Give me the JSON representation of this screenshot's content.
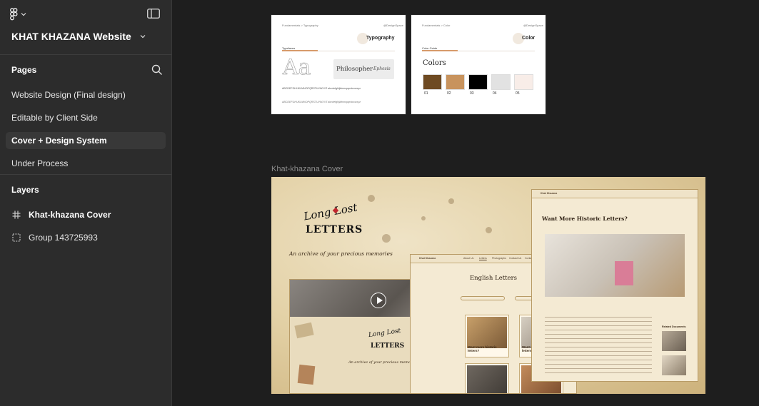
{
  "file": {
    "name": "KHAT KHAZANA Website"
  },
  "pages": {
    "title": "Pages",
    "items": [
      {
        "label": "Website Design (Final design)"
      },
      {
        "label": "Editable by Client Side"
      },
      {
        "label": "Cover + Design System"
      },
      {
        "label": "Under Process"
      }
    ]
  },
  "layers": {
    "title": "Layers",
    "items": [
      {
        "label": "Khat-khazana Cover"
      },
      {
        "label": "Group 143725993"
      }
    ]
  },
  "canvas": {
    "typography_frame": {
      "breadcrumb": "Fundamentals > Typography",
      "tag": "@DesignSpace",
      "title": "Typography",
      "section": "Typefaces",
      "sample_glyph": "Aa",
      "font_name": "Philosopher",
      "script_sample": "Ephesis",
      "alphabet": "ABCDEFGHIJKLMNOPQRSTUVWXYZ abcdefghijklmnopqrstuvwxyz"
    },
    "color_frame": {
      "breadcrumb": "Fundamentals > Color",
      "tag": "@DesignSpace",
      "title": "Color",
      "section": "Color Guide",
      "heading": "Colors",
      "swatches": [
        {
          "label": "01",
          "color": "#6e4a22"
        },
        {
          "label": "02",
          "color": "#c8935d"
        },
        {
          "label": "03",
          "color": "#000000"
        },
        {
          "label": "04",
          "color": "#e2e2e2"
        },
        {
          "label": "05",
          "color": "#f8ede8"
        }
      ]
    },
    "cover": {
      "label": "Khat-khazana Cover",
      "logo_line1": "Long Lost",
      "logo_line2": "LETTERS",
      "tagline": "An archive of your precious memories",
      "mini_site": {
        "brand": "Khat Khazana",
        "nav": [
          "About Us",
          "Letters",
          "Photographs",
          "Contact Us",
          "Contact Editor & Photographer",
          "Share"
        ],
        "page_title": "English Letters",
        "card1": "Want more historic letters?",
        "card2": "Want more historic letters?"
      },
      "right_site": {
        "heading": "Want More Historic Letters?",
        "sidebar_title": "Related Documents"
      }
    }
  }
}
